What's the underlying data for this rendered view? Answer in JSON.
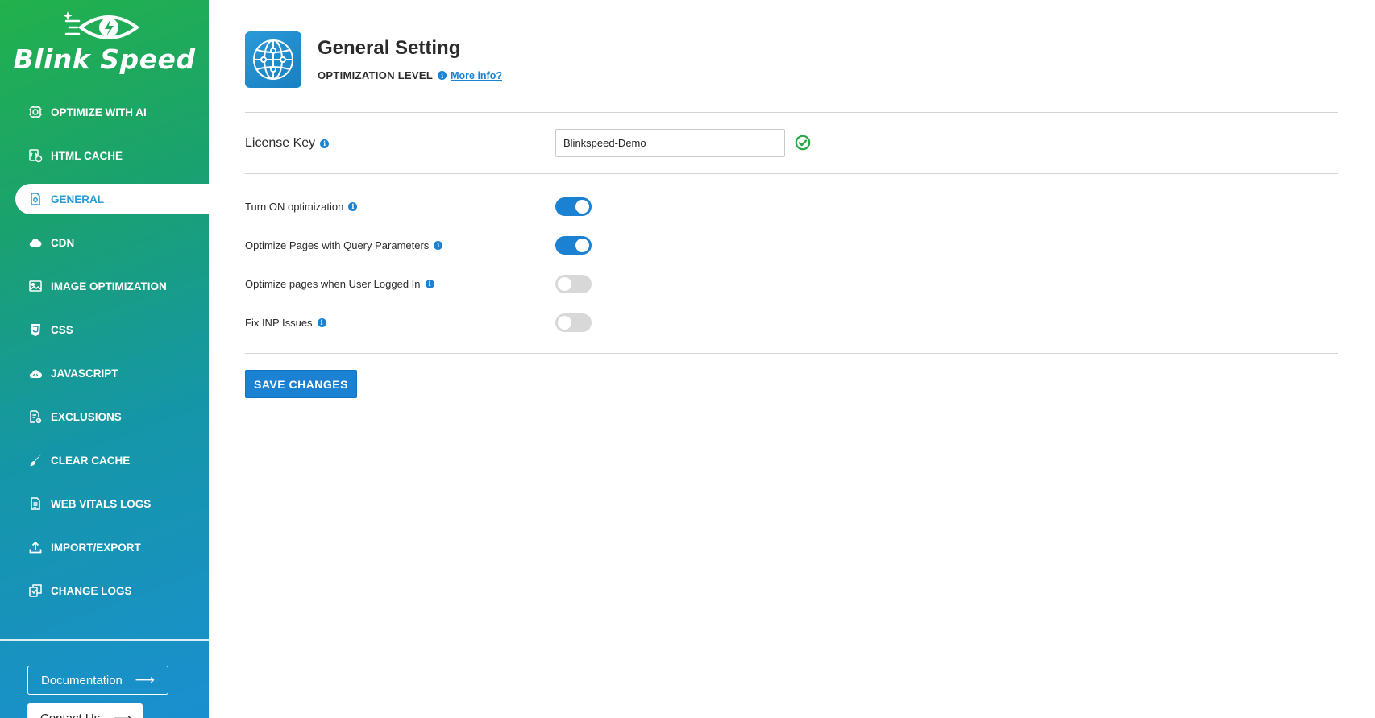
{
  "brand": {
    "logo_text": "Blink Speed"
  },
  "sidebar": {
    "active_index": 2,
    "items": [
      {
        "label": "OPTIMIZE WITH AI",
        "icon": "ai-chip-icon"
      },
      {
        "label": "HTML CACHE",
        "icon": "html-cache-icon"
      },
      {
        "label": "GENERAL",
        "icon": "document-gear-icon"
      },
      {
        "label": "CDN",
        "icon": "cloud-icon"
      },
      {
        "label": "IMAGE OPTIMIZATION",
        "icon": "image-icon"
      },
      {
        "label": "CSS",
        "icon": "css-icon"
      },
      {
        "label": "JAVASCRIPT",
        "icon": "cloud-code-icon"
      },
      {
        "label": "EXCLUSIONS",
        "icon": "exclusion-document-icon"
      },
      {
        "label": "CLEAR CACHE",
        "icon": "brush-icon"
      },
      {
        "label": "WEB VITALS LOGS",
        "icon": "log-document-icon"
      },
      {
        "label": "IMPORT/EXPORT",
        "icon": "upload-icon"
      },
      {
        "label": "CHANGE LOGS",
        "icon": "change-log-icon"
      }
    ],
    "documentation_label": "Documentation",
    "contact_label": "Contact Us"
  },
  "header": {
    "title": "General Setting",
    "subtitle": "OPTIMIZATION LEVEL",
    "more_info": "More info?"
  },
  "license": {
    "label": "License Key",
    "value": "Blinkspeed-Demo",
    "valid": true
  },
  "options": [
    {
      "label": "Turn ON optimization",
      "enabled": true
    },
    {
      "label": "Optimize Pages with Query Parameters",
      "enabled": true
    },
    {
      "label": "Optimize pages when User Logged In",
      "enabled": false
    },
    {
      "label": "Fix INP Issues",
      "enabled": false
    }
  ],
  "actions": {
    "save_label": "SAVE CHANGES"
  },
  "colors": {
    "accent": "#1b82d3",
    "sidebar_top": "#22b14c",
    "sidebar_bottom": "#1a8fd0",
    "valid": "#28a745"
  }
}
